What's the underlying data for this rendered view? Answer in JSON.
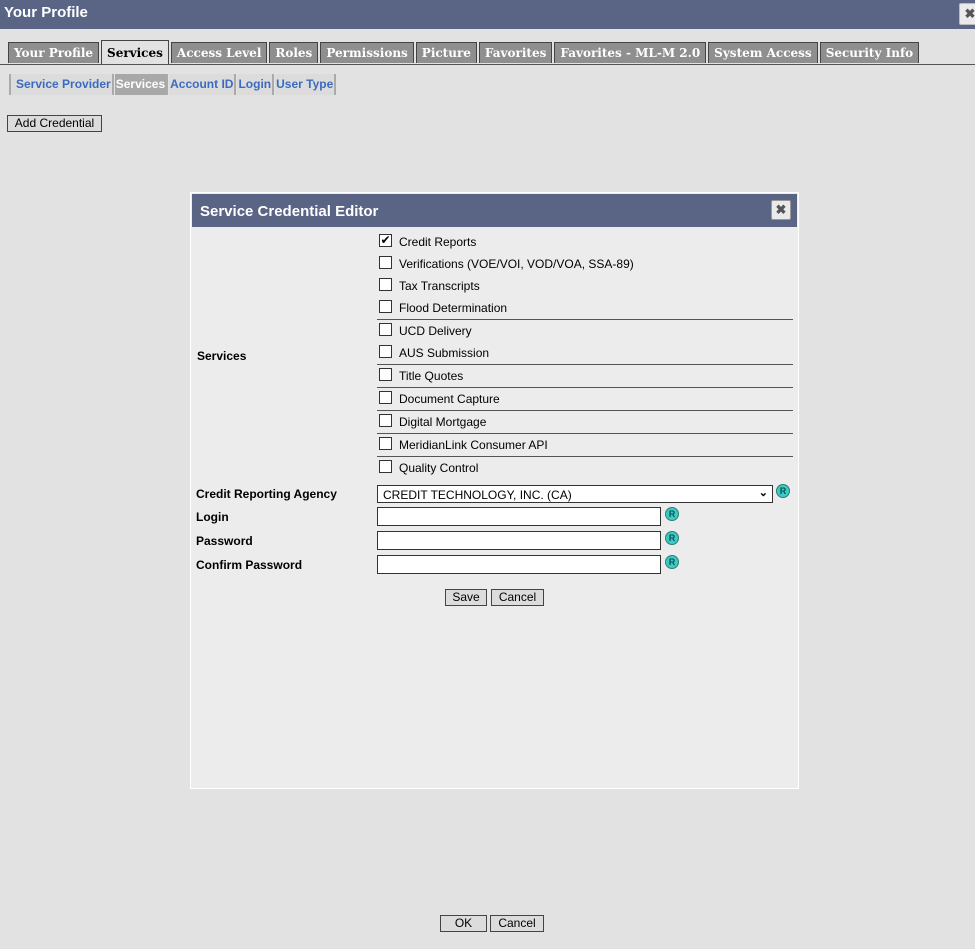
{
  "window": {
    "title": "Your Profile",
    "close_glyph": "✖"
  },
  "tabs": [
    {
      "label": "Your Profile"
    },
    {
      "label": "Services"
    },
    {
      "label": "Access Level"
    },
    {
      "label": "Roles"
    },
    {
      "label": "Permissions"
    },
    {
      "label": "Picture"
    },
    {
      "label": "Favorites"
    },
    {
      "label": "Favorites - ML-M 2.0"
    },
    {
      "label": "System Access"
    },
    {
      "label": "Security Info"
    }
  ],
  "active_tab": "Services",
  "subtabs": [
    {
      "label": "Service Provider"
    },
    {
      "label": "Services"
    },
    {
      "label": "Account ID"
    },
    {
      "label": "Login"
    },
    {
      "label": "User Type"
    }
  ],
  "active_subtab": "Services",
  "add_credential_label": "Add Credential",
  "dialog": {
    "title": "Service Credential Editor",
    "close_glyph": "✖",
    "services_label": "Services",
    "services": [
      {
        "label": "Credit Reports",
        "checked": true
      },
      {
        "label": "Verifications (VOE/VOI, VOD/VOA, SSA-89)",
        "checked": false
      },
      {
        "label": "Tax Transcripts",
        "checked": false
      },
      {
        "label": "Flood Determination",
        "checked": false
      },
      {
        "label": "UCD Delivery",
        "checked": false
      },
      {
        "label": "AUS Submission",
        "checked": false
      },
      {
        "label": "Title Quotes",
        "checked": false
      },
      {
        "label": "Document Capture",
        "checked": false
      },
      {
        "label": "Digital Mortgage",
        "checked": false
      },
      {
        "label": "MeridianLink Consumer API",
        "checked": false
      },
      {
        "label": "Quality Control",
        "checked": false
      }
    ],
    "cra_label": "Credit Reporting Agency",
    "cra_value": "CREDIT TECHNOLOGY, INC. (CA)",
    "login_label": "Login",
    "login_value": "",
    "password_label": "Password",
    "password_value": "",
    "confirm_password_label": "Confirm Password",
    "confirm_password_value": "",
    "required_glyph": "R",
    "save_label": "Save",
    "cancel_label": "Cancel"
  },
  "footer": {
    "ok_label": "OK",
    "cancel_label": "Cancel"
  },
  "colors": {
    "header": "#5a6586",
    "link": "#3b6bbf",
    "required": "#3fc7cf"
  }
}
